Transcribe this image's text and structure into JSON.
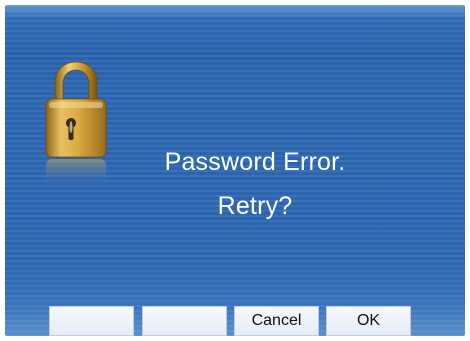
{
  "dialog": {
    "icon": "padlock-icon",
    "message_line1": "Password Error.",
    "message_line2": "Retry?"
  },
  "softkeys": [
    {
      "label": ""
    },
    {
      "label": ""
    },
    {
      "label": "Cancel"
    },
    {
      "label": "OK"
    }
  ],
  "colors": {
    "background": "#2c66b0",
    "text": "#ffffff",
    "lock_gold": "#c99a3a",
    "button_face": "#eef3fa"
  }
}
